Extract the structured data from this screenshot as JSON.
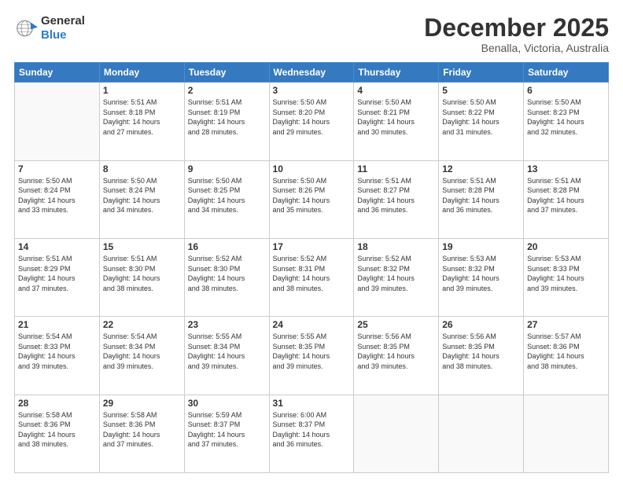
{
  "logo": {
    "line1": "General",
    "line2": "Blue"
  },
  "header": {
    "month": "December 2025",
    "location": "Benalla, Victoria, Australia"
  },
  "weekdays": [
    "Sunday",
    "Monday",
    "Tuesday",
    "Wednesday",
    "Thursday",
    "Friday",
    "Saturday"
  ],
  "weeks": [
    [
      {
        "day": "",
        "info": ""
      },
      {
        "day": "1",
        "info": "Sunrise: 5:51 AM\nSunset: 8:18 PM\nDaylight: 14 hours\nand 27 minutes."
      },
      {
        "day": "2",
        "info": "Sunrise: 5:51 AM\nSunset: 8:19 PM\nDaylight: 14 hours\nand 28 minutes."
      },
      {
        "day": "3",
        "info": "Sunrise: 5:50 AM\nSunset: 8:20 PM\nDaylight: 14 hours\nand 29 minutes."
      },
      {
        "day": "4",
        "info": "Sunrise: 5:50 AM\nSunset: 8:21 PM\nDaylight: 14 hours\nand 30 minutes."
      },
      {
        "day": "5",
        "info": "Sunrise: 5:50 AM\nSunset: 8:22 PM\nDaylight: 14 hours\nand 31 minutes."
      },
      {
        "day": "6",
        "info": "Sunrise: 5:50 AM\nSunset: 8:23 PM\nDaylight: 14 hours\nand 32 minutes."
      }
    ],
    [
      {
        "day": "7",
        "info": "Sunrise: 5:50 AM\nSunset: 8:24 PM\nDaylight: 14 hours\nand 33 minutes."
      },
      {
        "day": "8",
        "info": "Sunrise: 5:50 AM\nSunset: 8:24 PM\nDaylight: 14 hours\nand 34 minutes."
      },
      {
        "day": "9",
        "info": "Sunrise: 5:50 AM\nSunset: 8:25 PM\nDaylight: 14 hours\nand 34 minutes."
      },
      {
        "day": "10",
        "info": "Sunrise: 5:50 AM\nSunset: 8:26 PM\nDaylight: 14 hours\nand 35 minutes."
      },
      {
        "day": "11",
        "info": "Sunrise: 5:51 AM\nSunset: 8:27 PM\nDaylight: 14 hours\nand 36 minutes."
      },
      {
        "day": "12",
        "info": "Sunrise: 5:51 AM\nSunset: 8:28 PM\nDaylight: 14 hours\nand 36 minutes."
      },
      {
        "day": "13",
        "info": "Sunrise: 5:51 AM\nSunset: 8:28 PM\nDaylight: 14 hours\nand 37 minutes."
      }
    ],
    [
      {
        "day": "14",
        "info": "Sunrise: 5:51 AM\nSunset: 8:29 PM\nDaylight: 14 hours\nand 37 minutes."
      },
      {
        "day": "15",
        "info": "Sunrise: 5:51 AM\nSunset: 8:30 PM\nDaylight: 14 hours\nand 38 minutes."
      },
      {
        "day": "16",
        "info": "Sunrise: 5:52 AM\nSunset: 8:30 PM\nDaylight: 14 hours\nand 38 minutes."
      },
      {
        "day": "17",
        "info": "Sunrise: 5:52 AM\nSunset: 8:31 PM\nDaylight: 14 hours\nand 38 minutes."
      },
      {
        "day": "18",
        "info": "Sunrise: 5:52 AM\nSunset: 8:32 PM\nDaylight: 14 hours\nand 39 minutes."
      },
      {
        "day": "19",
        "info": "Sunrise: 5:53 AM\nSunset: 8:32 PM\nDaylight: 14 hours\nand 39 minutes."
      },
      {
        "day": "20",
        "info": "Sunrise: 5:53 AM\nSunset: 8:33 PM\nDaylight: 14 hours\nand 39 minutes."
      }
    ],
    [
      {
        "day": "21",
        "info": "Sunrise: 5:54 AM\nSunset: 8:33 PM\nDaylight: 14 hours\nand 39 minutes."
      },
      {
        "day": "22",
        "info": "Sunrise: 5:54 AM\nSunset: 8:34 PM\nDaylight: 14 hours\nand 39 minutes."
      },
      {
        "day": "23",
        "info": "Sunrise: 5:55 AM\nSunset: 8:34 PM\nDaylight: 14 hours\nand 39 minutes."
      },
      {
        "day": "24",
        "info": "Sunrise: 5:55 AM\nSunset: 8:35 PM\nDaylight: 14 hours\nand 39 minutes."
      },
      {
        "day": "25",
        "info": "Sunrise: 5:56 AM\nSunset: 8:35 PM\nDaylight: 14 hours\nand 39 minutes."
      },
      {
        "day": "26",
        "info": "Sunrise: 5:56 AM\nSunset: 8:35 PM\nDaylight: 14 hours\nand 38 minutes."
      },
      {
        "day": "27",
        "info": "Sunrise: 5:57 AM\nSunset: 8:36 PM\nDaylight: 14 hours\nand 38 minutes."
      }
    ],
    [
      {
        "day": "28",
        "info": "Sunrise: 5:58 AM\nSunset: 8:36 PM\nDaylight: 14 hours\nand 38 minutes."
      },
      {
        "day": "29",
        "info": "Sunrise: 5:58 AM\nSunset: 8:36 PM\nDaylight: 14 hours\nand 37 minutes."
      },
      {
        "day": "30",
        "info": "Sunrise: 5:59 AM\nSunset: 8:37 PM\nDaylight: 14 hours\nand 37 minutes."
      },
      {
        "day": "31",
        "info": "Sunrise: 6:00 AM\nSunset: 8:37 PM\nDaylight: 14 hours\nand 36 minutes."
      },
      {
        "day": "",
        "info": ""
      },
      {
        "day": "",
        "info": ""
      },
      {
        "day": "",
        "info": ""
      }
    ]
  ]
}
